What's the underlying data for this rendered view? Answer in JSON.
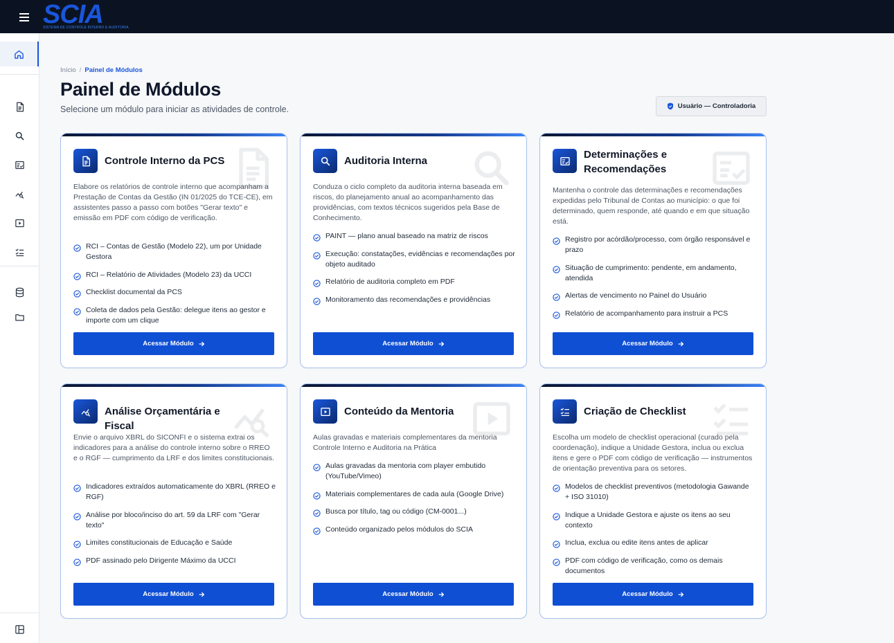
{
  "app": {
    "logo_text": "SCIA",
    "logo_subtitle": "SISTEMA DE CONTROLE INTERNO E AUDITORIA"
  },
  "sidebar": {
    "items": [
      {
        "icon": "home-icon",
        "active": true
      },
      {
        "icon": "document-icon"
      },
      {
        "icon": "search-icon"
      },
      {
        "icon": "checklist-board-icon"
      },
      {
        "icon": "chart-analysis-icon"
      },
      {
        "icon": "play-icon"
      },
      {
        "icon": "list-check-icon"
      },
      {
        "icon": "database-icon"
      },
      {
        "icon": "folder-icon"
      },
      {
        "icon": "layout-panel-icon"
      }
    ]
  },
  "breadcrumb": {
    "home": "Início",
    "separator": "/",
    "current": "Painel de Módulos"
  },
  "page": {
    "title": "Painel de Módulos",
    "subtitle": "Selecione um módulo para iniciar as atividades de controle."
  },
  "user_badge": {
    "label": "Usuário — Controladoria"
  },
  "cards": [
    {
      "icon": "document-icon",
      "title": "Controle Interno da PCS",
      "description": "Elabore os relatórios de controle interno que acompanham a Prestação de Contas da Gestão (IN 01/2025 do TCE-CE), em assistentes passo a passo com botões \"Gerar texto\" e emissão em PDF com código de verificação.",
      "features": [
        "RCI – Contas de Gestão (Modelo 22), um por Unidade Gestora",
        "RCI – Relatório de Atividades (Modelo 23) da UCCI",
        "Checklist documental da PCS",
        "Coleta de dados pela Gestão: delegue itens ao gestor e importe com um clique"
      ],
      "button": "Acessar Módulo"
    },
    {
      "icon": "search-icon",
      "title": "Auditoria Interna",
      "description": "Conduza o ciclo completo da auditoria interna baseada em riscos, do planejamento anual ao acompanhamento das providências, com textos técnicos sugeridos pela Base de Conhecimento.",
      "features": [
        "PAINT — plano anual baseado na matriz de riscos",
        "Execução: constatações, evidências e recomendações por objeto auditado",
        "Relatório de auditoria completo em PDF",
        "Monitoramento das recomendações e providências"
      ],
      "button": "Acessar Módulo"
    },
    {
      "icon": "checklist-board-icon",
      "title": "Determinações e Recomendações",
      "description": "Mantenha o controle das determinações e recomendações expedidas pelo Tribunal de Contas ao município: o que foi determinado, quem responde, até quando e em que situação está.",
      "features": [
        "Registro por acórdão/processo, com órgão responsável e prazo",
        "Situação de cumprimento: pendente, em andamento, atendida",
        "Alertas de vencimento no Painel do Usuário",
        "Relatório de acompanhamento para instruir a PCS"
      ],
      "button": "Acessar Módulo"
    },
    {
      "icon": "chart-analysis-icon",
      "title": "Análise Orçamentária e Fiscal",
      "description": "Envie o arquivo XBRL do SICONFI e o sistema extrai os indicadores para a análise do controle interno sobre o RREO e o RGF — cumprimento da LRF e dos limites constitucionais.",
      "features": [
        "Indicadores extraídos automaticamente do XBRL (RREO e RGF)",
        "Análise por bloco/inciso do art. 59 da LRF com \"Gerar texto\"",
        "Limites constitucionais de Educação e Saúde",
        "PDF assinado pelo Dirigente Máximo da UCCI"
      ],
      "button": "Acessar Módulo"
    },
    {
      "icon": "play-icon",
      "title": "Conteúdo da Mentoria",
      "description": "Aulas gravadas e materiais complementares da mentoria Controle Interno e Auditoria na Prática",
      "features": [
        "Aulas gravadas da mentoria com player embutido (YouTube/Vimeo)",
        "Materiais complementares de cada aula (Google Drive)",
        "Busca por título, tag ou código (CM-0001...)",
        "Conteúdo organizado pelos módulos do SCIA"
      ],
      "button": "Acessar Módulo"
    },
    {
      "icon": "list-check-icon",
      "title": "Criação de Checklist",
      "description": "Escolha um modelo de checklist operacional (curado pela coordenação), indique a Unidade Gestora, inclua ou exclua itens e gere o PDF com código de verificação — instrumentos de orientação preventiva para os setores.",
      "features": [
        "Modelos de checklist preventivos (metodologia Gawande + ISO 31010)",
        "Indique a Unidade Gestora e ajuste os itens ao seu contexto",
        "Inclua, exclua ou edite itens antes de aplicar",
        "PDF com código de verificação, como os demais documentos"
      ],
      "button": "Acessar Módulo"
    }
  ]
}
